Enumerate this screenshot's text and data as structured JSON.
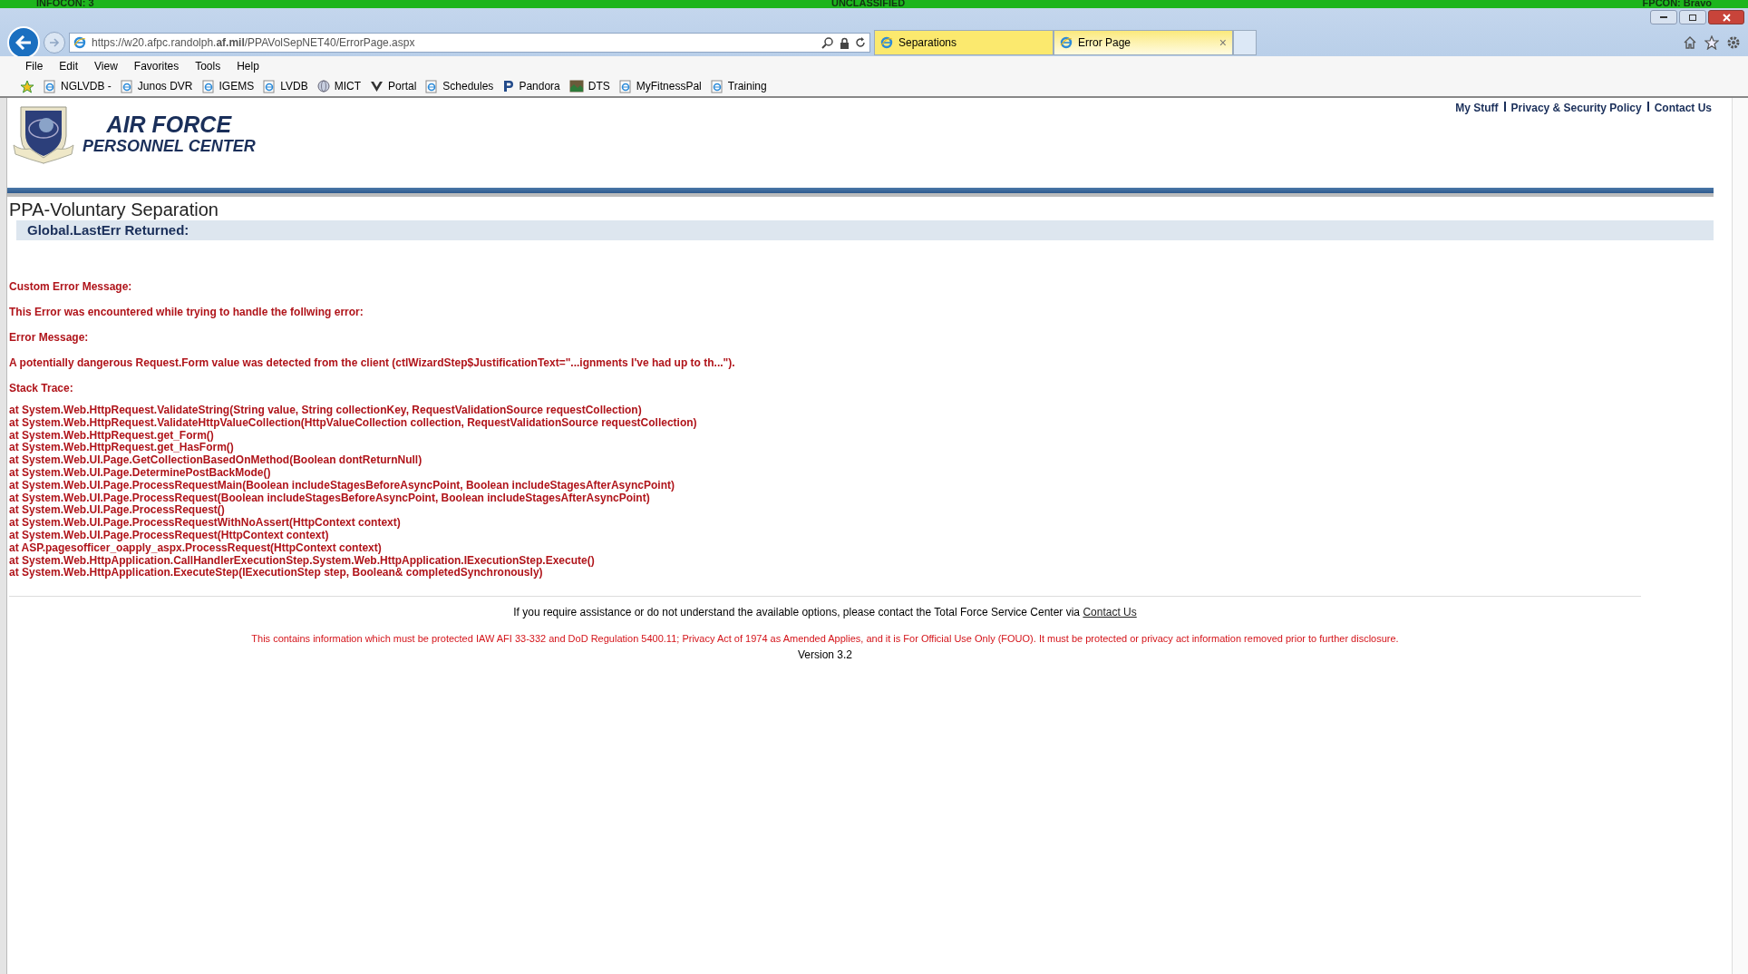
{
  "classification_bar": {
    "left": "INFOCON: 3",
    "center": "UNCLASSIFIED",
    "right": "FPCON: Bravo"
  },
  "address_bar": {
    "url": "https://w20.afpc.randolph.**af.mil**/PPAVolSepNET40/ErrorPage.aspx"
  },
  "tabs": [
    {
      "label": "Separations",
      "selected": false
    },
    {
      "label": "Error Page",
      "selected": true,
      "close": "×"
    }
  ],
  "menu": [
    "File",
    "Edit",
    "View",
    "Favorites",
    "Tools",
    "Help"
  ],
  "favorites": [
    {
      "label": "NGLVDB -",
      "kind": "page"
    },
    {
      "label": "Junos DVR",
      "kind": "page"
    },
    {
      "label": "IGEMS",
      "kind": "page"
    },
    {
      "label": "LVDB",
      "kind": "page"
    },
    {
      "label": "MICT",
      "kind": "globe"
    },
    {
      "label": "Portal",
      "kind": "wings"
    },
    {
      "label": "Schedules",
      "kind": "page"
    },
    {
      "label": "Pandora",
      "kind": "p"
    },
    {
      "label": "DTS",
      "kind": "image"
    },
    {
      "label": "MyFitnessPal",
      "kind": "page"
    },
    {
      "label": "Training",
      "kind": "page"
    }
  ],
  "top_links": [
    "My Stuff",
    "Privacy & Security Policy",
    "Contact Us"
  ],
  "header": {
    "line1": "AIR FORCE",
    "line2": "PERSONNEL CENTER"
  },
  "page_title": "PPA-Voluntary Separation",
  "section_heading": "Global.LastErr Returned:",
  "error_lines": [
    "Custom Error Message:",
    "This Error was encountered while trying to handle the follwing error:",
    "Error Message:",
    "A potentially dangerous Request.Form value was detected from the client (ctlWizardStep$JustificationText=\"...ignments I've had up to th...\").",
    "Stack Trace:"
  ],
  "stack_trace": [
    "at System.Web.HttpRequest.ValidateString(String value, String collectionKey, RequestValidationSource requestCollection)",
    "at System.Web.HttpRequest.ValidateHttpValueCollection(HttpValueCollection collection, RequestValidationSource requestCollection)",
    "at System.Web.HttpRequest.get_Form()",
    "at System.Web.HttpRequest.get_HasForm()",
    "at System.Web.UI.Page.GetCollectionBasedOnMethod(Boolean dontReturnNull)",
    "at System.Web.UI.Page.DeterminePostBackMode()",
    "at System.Web.UI.Page.ProcessRequestMain(Boolean includeStagesBeforeAsyncPoint, Boolean includeStagesAfterAsyncPoint)",
    "at System.Web.UI.Page.ProcessRequest(Boolean includeStagesBeforeAsyncPoint, Boolean includeStagesAfterAsyncPoint)",
    "at System.Web.UI.Page.ProcessRequest()",
    "at System.Web.UI.Page.ProcessRequestWithNoAssert(HttpContext context)",
    "at System.Web.UI.Page.ProcessRequest(HttpContext context)",
    "at ASP.pagesofficer_oapply_aspx.ProcessRequest(HttpContext context)",
    "at System.Web.HttpApplication.CallHandlerExecutionStep.System.Web.HttpApplication.IExecutionStep.Execute()",
    "at System.Web.HttpApplication.ExecuteStep(IExecutionStep step, Boolean& completedSynchronously)"
  ],
  "footer": {
    "assistance": "If you require assistance or do not understand the available options, please contact the Total Force Service Center via",
    "contact_link": "Contact Us",
    "privacy": "This contains information which must be protected IAW AFI 33-332 and DoD Regulation 5400.11; Privacy Act of 1974 as Amended Applies, and it is For Official Use Only (FOUO). It must be protected or privacy act information removed prior to further disclosure.",
    "version": "Version 3.2"
  }
}
